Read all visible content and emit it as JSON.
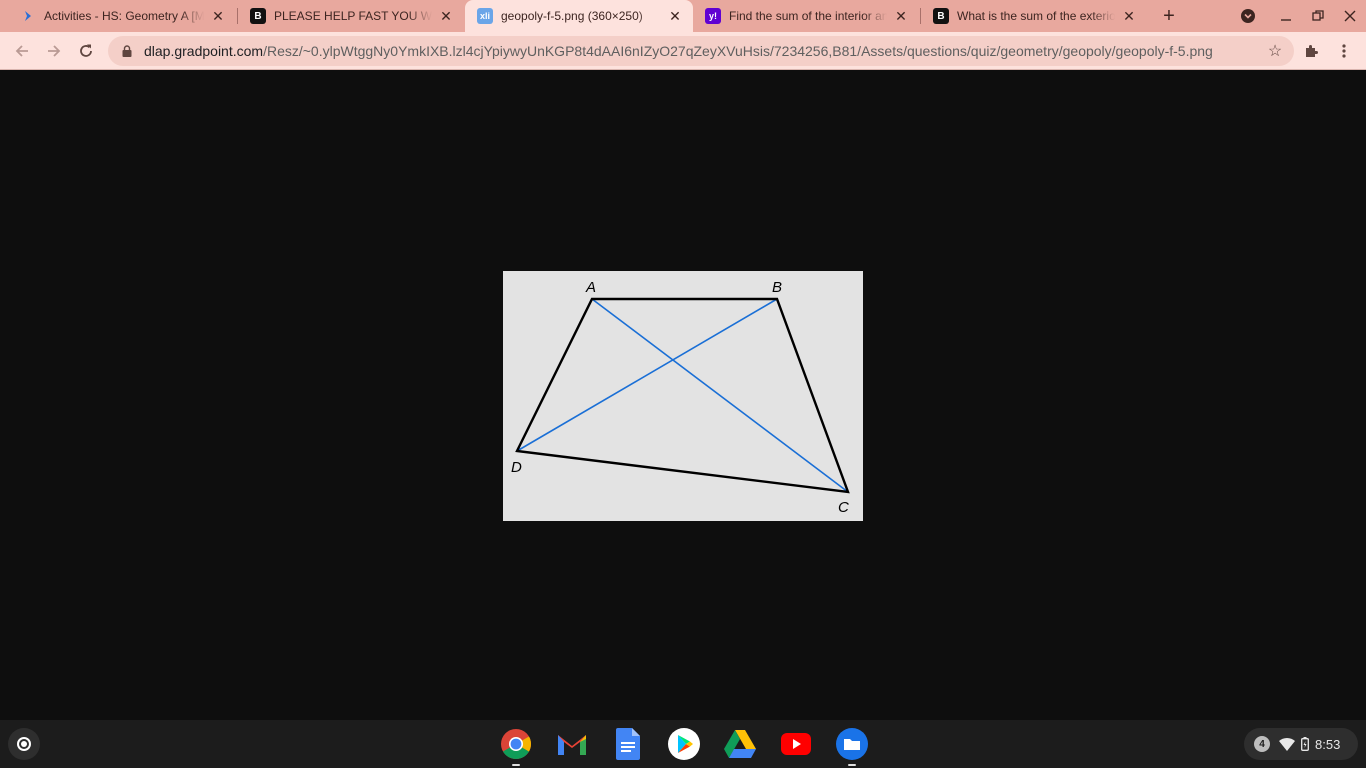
{
  "browser": {
    "tabs": [
      {
        "title": "Activities - HS: Geometry A [M",
        "favicon": "edgenuity-arrow-icon",
        "active": false
      },
      {
        "title": "PLEASE HELP FAST YOU WILL",
        "favicon": "brainly-b-icon",
        "favicon_text": "B",
        "active": false
      },
      {
        "title": "geopoly-f-5.png (360×250)",
        "favicon": "image-icon",
        "favicon_text": "xli",
        "active": true
      },
      {
        "title": "Find the sum of the interior an",
        "favicon": "yahoo-answers-icon",
        "favicon_text": "y!",
        "active": false
      },
      {
        "title": "What is the sum of the exterior",
        "favicon": "brainly-b-icon",
        "favicon_text": "B",
        "active": false
      }
    ],
    "new_tab_label": "+",
    "url_host": "dlap.gradpoint.com",
    "url_path": "/Resz/~0.ylpWtggNy0YmkIXB.lzl4cjYpiywyUnKGP8t4dAAI6nIZyO27qZeyXVuHsis/7234256,B81/Assets/questions/quiz/geometry/geopoly/geopoly-f-5.png",
    "colors": {
      "tabstrip": "#e8a89e",
      "active_tab": "#fde2dd",
      "omnibox": "#f4cfc8"
    }
  },
  "figure": {
    "vertex_labels": {
      "A": "A",
      "B": "B",
      "C": "C",
      "D": "D"
    },
    "side_color": "#000000",
    "diagonal_color": "#1a6fd6",
    "background": "#e3e3e3"
  },
  "shelf": {
    "apps": [
      "chrome-icon",
      "gmail-icon",
      "docs-icon",
      "play-store-icon",
      "drive-icon",
      "youtube-icon",
      "files-icon"
    ],
    "notification_count": "4",
    "time": "8:53"
  }
}
